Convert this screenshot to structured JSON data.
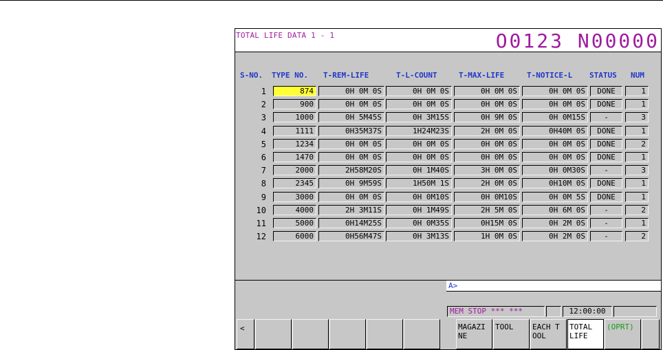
{
  "screen": {
    "title": "TOTAL LIFE DATA 1 - 1",
    "program": "O0123 N00000"
  },
  "columns": [
    "S-NO.",
    "TYPE NO.",
    "T-REM-LIFE",
    "T-L-COUNT",
    "T-MAX-LIFE",
    "T-NOTICE-L",
    "STATUS",
    "NUM"
  ],
  "rows": [
    {
      "sno": "1",
      "type": "874",
      "rem": "0H 0M 0S",
      "count": "0H 0M 0S",
      "max": "0H 0M 0S",
      "notice": "0H 0M 0S",
      "status": "DONE",
      "num": "1"
    },
    {
      "sno": "2",
      "type": "900",
      "rem": "0H 0M 0S",
      "count": "0H 0M 0S",
      "max": "0H 0M 0S",
      "notice": "0H 0M 0S",
      "status": "DONE",
      "num": "1"
    },
    {
      "sno": "3",
      "type": "1000",
      "rem": "0H 5M45S",
      "count": "0H 3M15S",
      "max": "0H 9M 0S",
      "notice": "0H 0M15S",
      "status": "-",
      "num": "3"
    },
    {
      "sno": "4",
      "type": "1111",
      "rem": "0H35M37S",
      "count": "1H24M23S",
      "max": "2H 0M 0S",
      "notice": "0H40M 0S",
      "status": "DONE",
      "num": "1"
    },
    {
      "sno": "5",
      "type": "1234",
      "rem": "0H 0M 0S",
      "count": "0H 0M 0S",
      "max": "0H 0M 0S",
      "notice": "0H 0M 0S",
      "status": "DONE",
      "num": "2"
    },
    {
      "sno": "6",
      "type": "1470",
      "rem": "0H 0M 0S",
      "count": "0H 0M 0S",
      "max": "0H 0M 0S",
      "notice": "0H 0M 0S",
      "status": "DONE",
      "num": "1"
    },
    {
      "sno": "7",
      "type": "2000",
      "rem": "2H58M20S",
      "count": "0H 1M40S",
      "max": "3H 0M 0S",
      "notice": "0H 0M30S",
      "status": "-",
      "num": "3"
    },
    {
      "sno": "8",
      "type": "2345",
      "rem": "0H 9M59S",
      "count": "1H50M 1S",
      "max": "2H 0M 0S",
      "notice": "0H10M 0S",
      "status": "DONE",
      "num": "1"
    },
    {
      "sno": "9",
      "type": "3000",
      "rem": "0H 0M 0S",
      "count": "0H 0M10S",
      "max": "0H 0M10S",
      "notice": "0H 0M 5S",
      "status": "DONE",
      "num": "1"
    },
    {
      "sno": "10",
      "type": "4000",
      "rem": "2H 3M11S",
      "count": "0H 1M49S",
      "max": "2H 5M 0S",
      "notice": "0H 6M 0S",
      "status": "-",
      "num": "2"
    },
    {
      "sno": "11",
      "type": "5000",
      "rem": "0H14M25S",
      "count": "0H 0M35S",
      "max": "0H15M 0S",
      "notice": "0H 2M 0S",
      "status": "-",
      "num": "1"
    },
    {
      "sno": "12",
      "type": "6000",
      "rem": "0H56M47S",
      "count": "0H 3M13S",
      "max": "1H 0M 0S",
      "notice": "0H 2M 0S",
      "status": "-",
      "num": "2"
    }
  ],
  "input_prompt": "A>",
  "status_bar": {
    "mode": "MEM  STOP *** ***",
    "time": "12:00:00"
  },
  "softkeys": {
    "left_arrow": "<",
    "magazine": "MAGAZI\nNE",
    "tool": "TOOL",
    "each_tool": "EACH T\nOOL",
    "total_life": "TOTAL\nLIFE",
    "oprt": "(OPRT)"
  },
  "colors": {
    "title": "#a01aa0",
    "header": "#2238c8",
    "highlight": "#ffff33",
    "panel": "#c7c7c7",
    "oprt": "#1a9a1a"
  }
}
